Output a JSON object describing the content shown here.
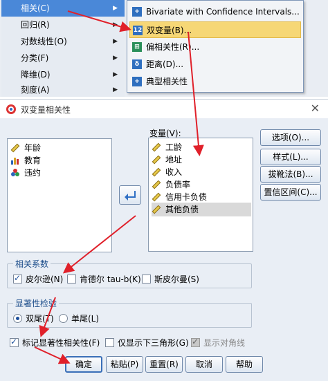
{
  "menu": {
    "items": [
      {
        "label": "相关(C)"
      },
      {
        "label": "回归(R)"
      },
      {
        "label": "对数线性(O)"
      },
      {
        "label": "分类(F)"
      },
      {
        "label": "降维(D)"
      },
      {
        "label": "刻度(A)"
      }
    ],
    "submenu": [
      {
        "label": "Bivariate with Confidence Intervals...",
        "icon": "bivariate-icon"
      },
      {
        "label": "双变量(B)...",
        "icon": "bivariate-12-icon"
      },
      {
        "label": "偏相关性(R)...",
        "icon": "partial-icon"
      },
      {
        "label": "距离(D)...",
        "icon": "distance-icon"
      },
      {
        "label": "典型相关性",
        "icon": "canonical-icon"
      }
    ]
  },
  "dialog": {
    "title": "双变量相关性",
    "source_vars": [
      "年龄",
      "教育",
      "违约"
    ],
    "variables_label": "变量(V):",
    "target_vars": [
      "工龄",
      "地址",
      "收入",
      "负债率",
      "信用卡负债",
      "其他负债"
    ],
    "side_buttons": [
      "选项(O)...",
      "样式(L)...",
      "拔靴法(B)...",
      "置信区间(C)..."
    ],
    "coef_group": {
      "label": "相关系数",
      "options": [
        {
          "label": "皮尔逊(N)",
          "checked": true
        },
        {
          "label": "肯德尔 tau-b(K)",
          "checked": false
        },
        {
          "label": "斯皮尔曼(S)",
          "checked": false
        }
      ]
    },
    "sig_group": {
      "label": "显著性检验",
      "options": [
        {
          "label": "双尾(T)",
          "selected": true
        },
        {
          "label": "单尾(L)",
          "selected": false
        }
      ]
    },
    "bottom_checks": [
      {
        "label": "标记显著性相关性(F)",
        "checked": true
      },
      {
        "label": "仅显示下三角形(G)",
        "checked": false
      },
      {
        "label": "显示对角线",
        "checked": true,
        "disabled": true
      }
    ],
    "buttons": [
      "确定",
      "粘贴(P)",
      "重置(R)",
      "取消",
      "帮助"
    ]
  },
  "colors": {
    "menu_highlight": "#4a88d8",
    "submenu_highlight": "#f6d776",
    "annotation_arrow": "#e0202a",
    "group_label": "#1e4f8c"
  }
}
